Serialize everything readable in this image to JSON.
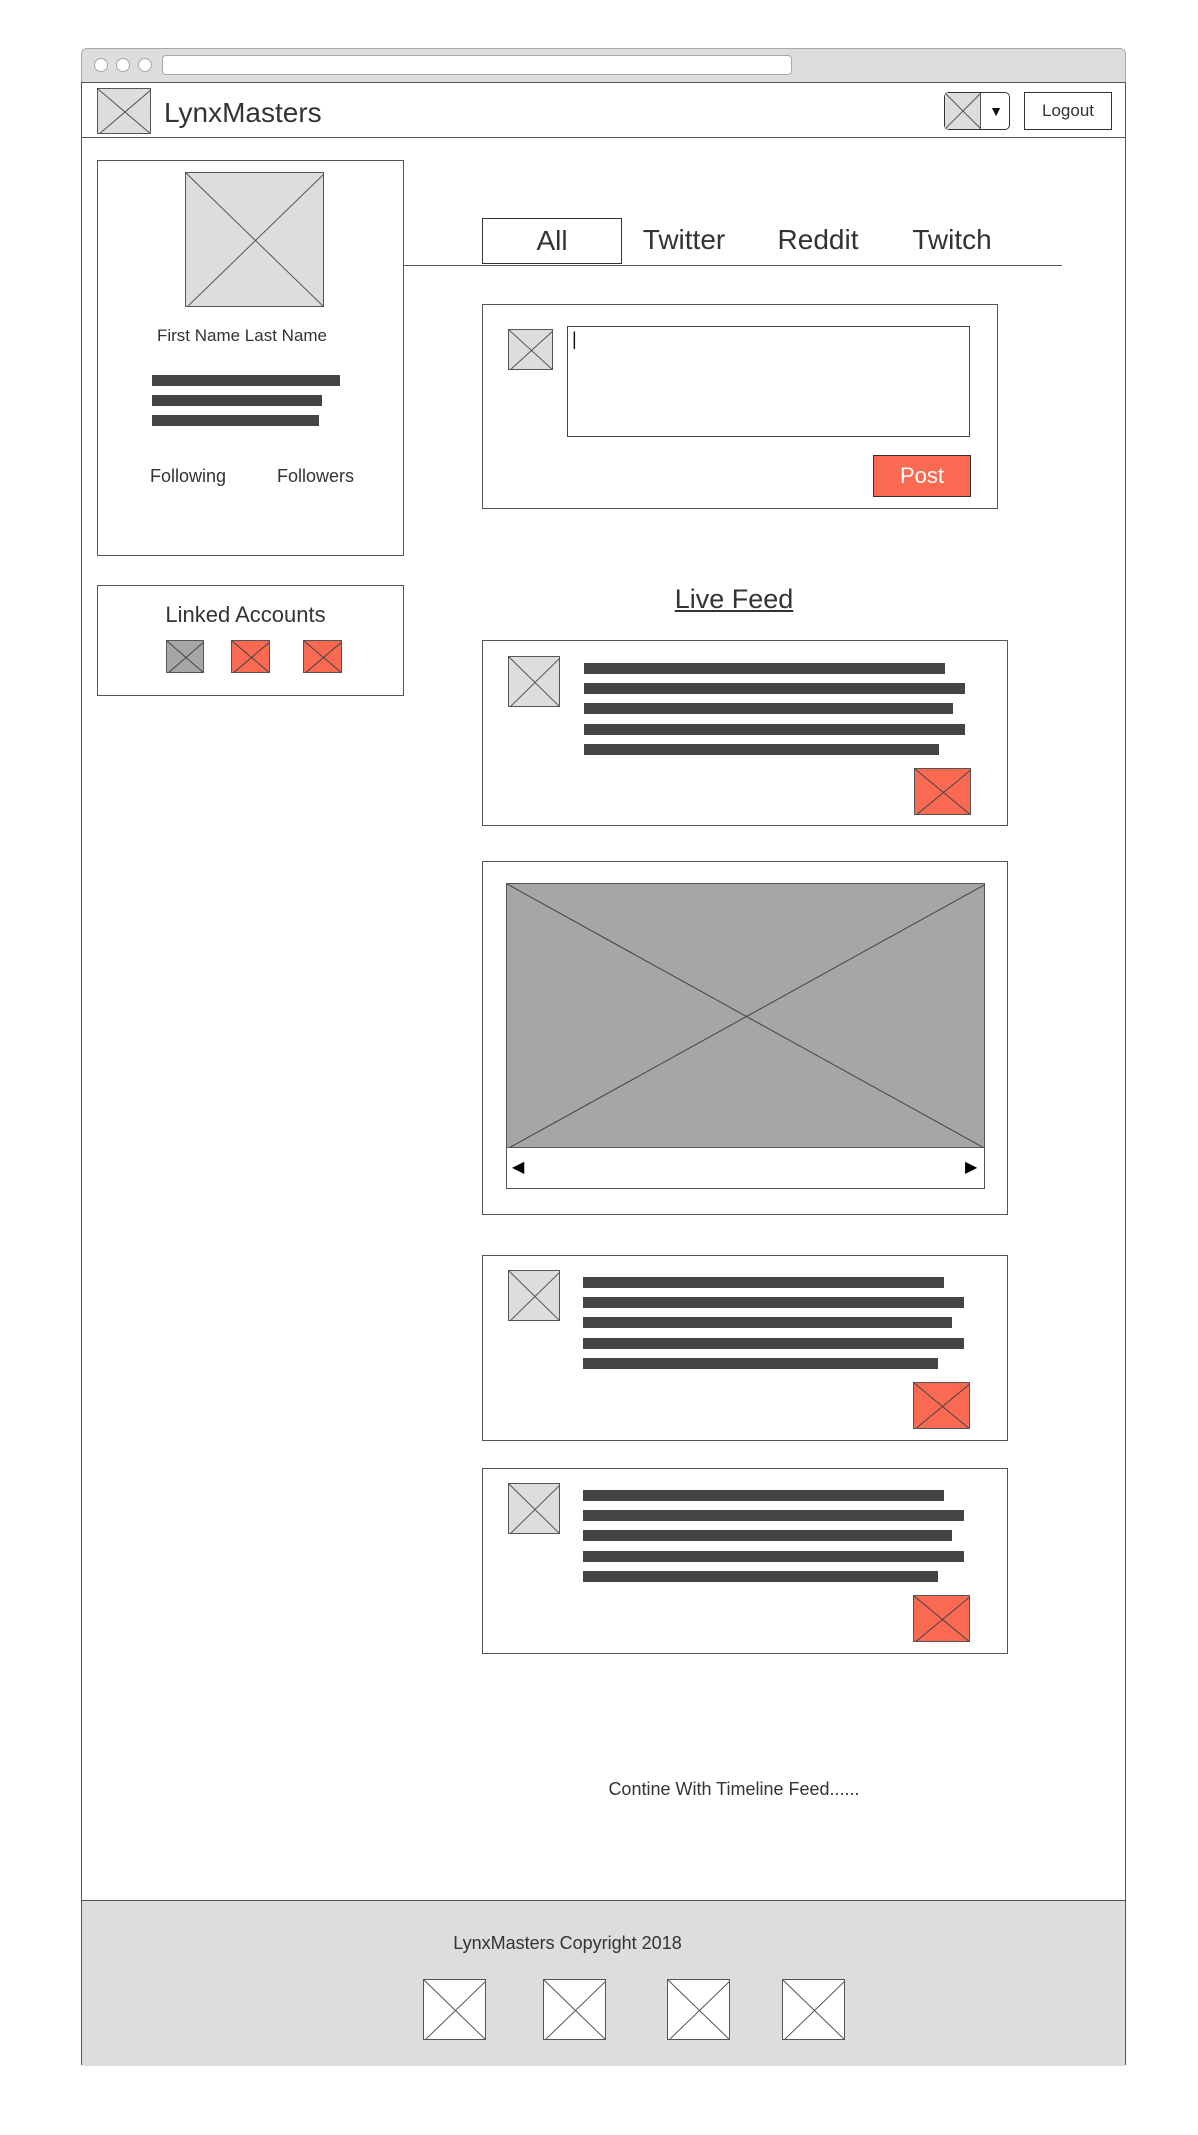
{
  "app": {
    "brand": "LynxMasters",
    "logout_label": "Logout",
    "dropdown_arrow": "▼"
  },
  "profile": {
    "name": "First Name Last Name",
    "following_label": "Following",
    "followers_label": "Followers"
  },
  "linked_accounts": {
    "title": "Linked Accounts"
  },
  "tabs": [
    {
      "label": "All",
      "active": true
    },
    {
      "label": "Twitter",
      "active": false
    },
    {
      "label": "Reddit",
      "active": false
    },
    {
      "label": "Twitch",
      "active": false
    }
  ],
  "composer": {
    "value": "|",
    "post_label": "Post"
  },
  "feed": {
    "title": "Live Feed",
    "carousel_prev": "◀",
    "carousel_next": "▶",
    "continue_text": "Contine With Timeline Feed......"
  },
  "footer": {
    "copyright": "LynxMasters Copyright 2018"
  },
  "colors": {
    "accent": "#fa6a53",
    "placeholder_gray": "#dddddd",
    "placeholder_dark": "#a6a6a6",
    "text_bar": "#444444"
  }
}
